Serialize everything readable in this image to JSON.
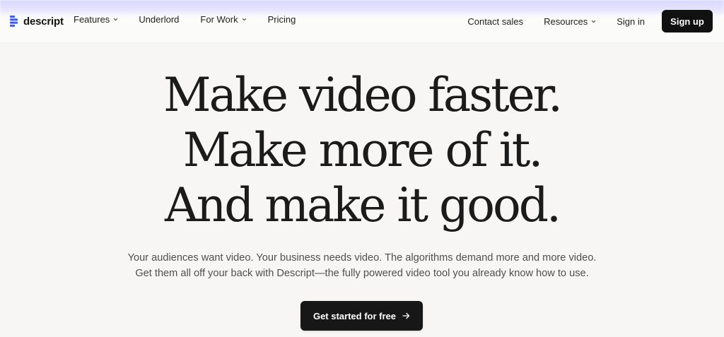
{
  "brand": {
    "name": "descript",
    "logo_icon": "descript-logo-icon"
  },
  "nav": {
    "left": [
      {
        "label": "Features",
        "has_dropdown": true
      },
      {
        "label": "Underlord",
        "has_dropdown": false
      },
      {
        "label": "For Work",
        "has_dropdown": true
      },
      {
        "label": "Pricing",
        "has_dropdown": false
      }
    ],
    "right": [
      {
        "label": "Contact sales",
        "has_dropdown": false
      },
      {
        "label": "Resources",
        "has_dropdown": true
      },
      {
        "label": "Sign in",
        "has_dropdown": false
      }
    ],
    "signup_label": "Sign up"
  },
  "hero": {
    "title_lines": [
      "Make video faster.",
      "Make more of it.",
      "And make it good."
    ],
    "subtitle_lines": [
      "Your audiences want video. Your business needs video. The algorithms demand more and more video.",
      "Get them all off your back with Descript—the fully powered video tool you already know how to use."
    ],
    "cta_label": "Get started for free",
    "cta_icon": "arrow-right-icon"
  },
  "colors": {
    "background": "#f7f6f4",
    "top_glow": "#a9a9ff",
    "button_dark": "#111111",
    "logo_blue": "#3b5bfd"
  }
}
